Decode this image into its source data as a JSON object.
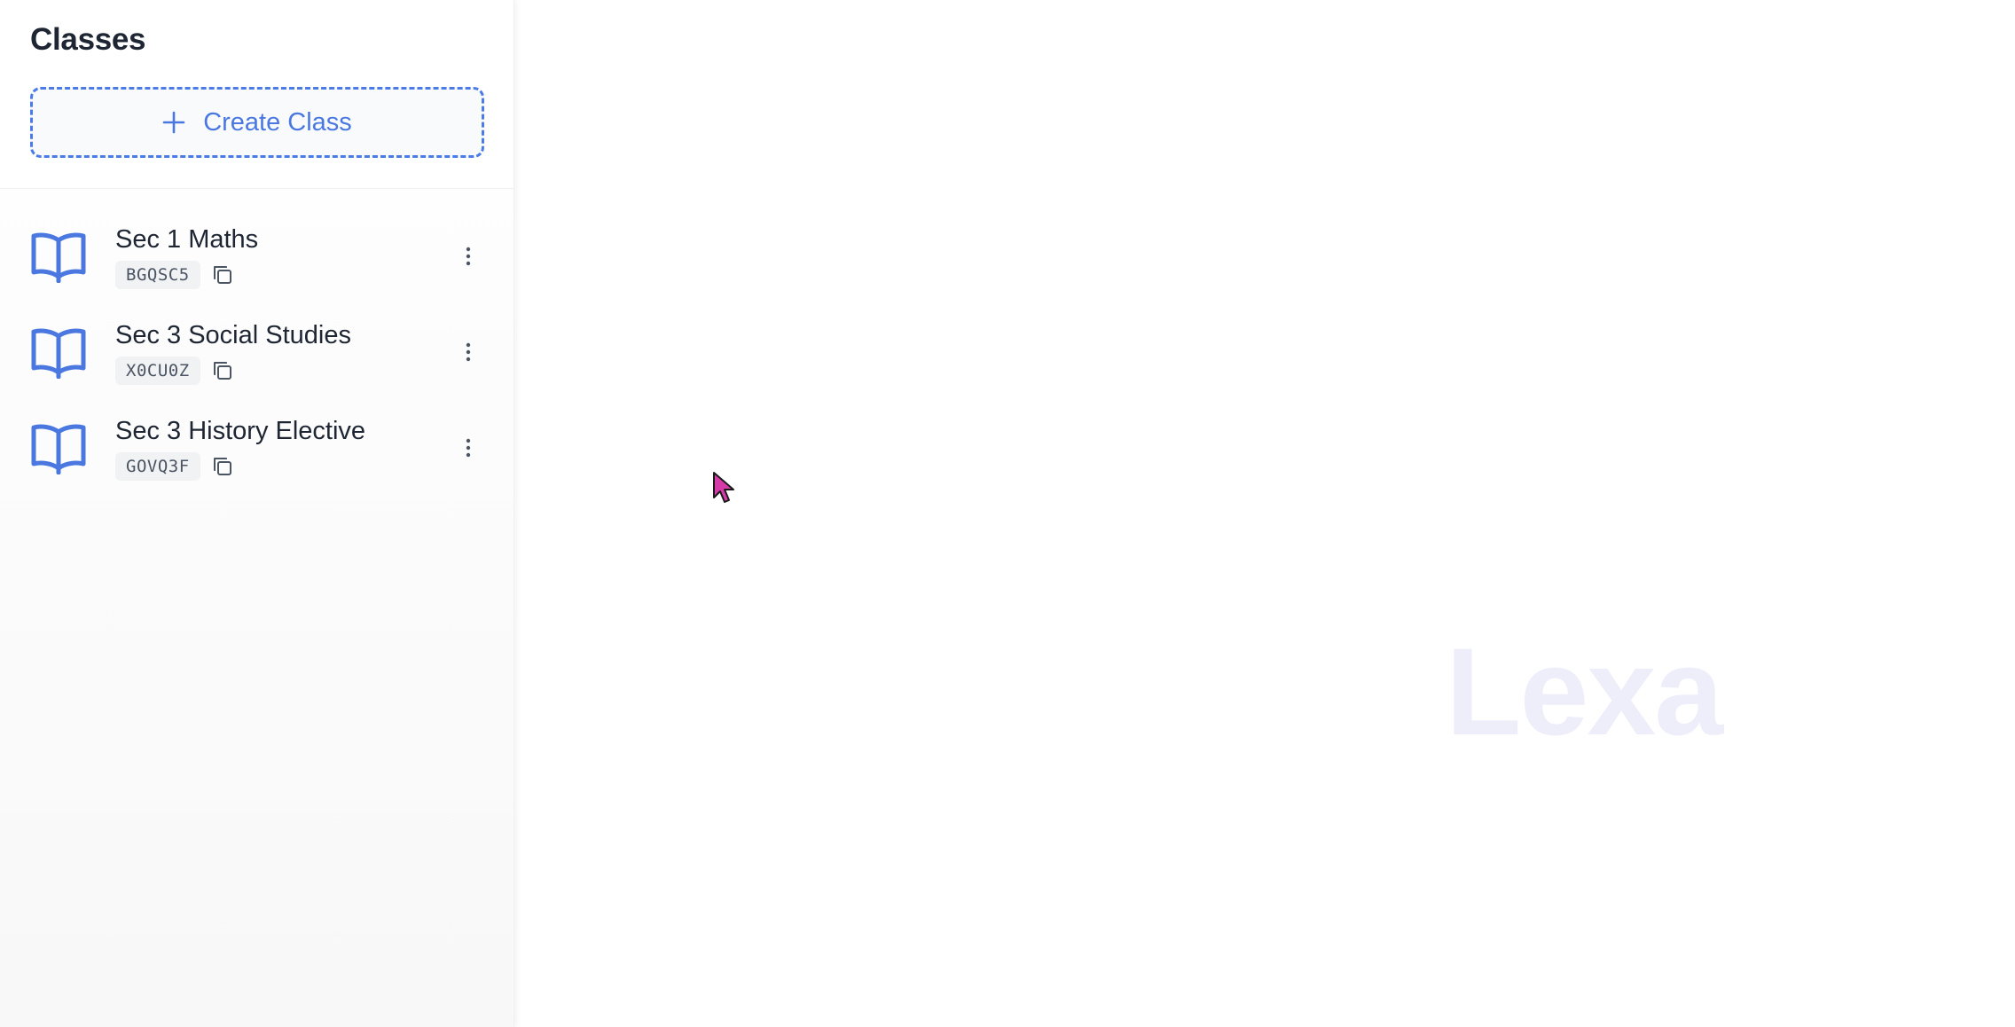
{
  "sidebar": {
    "title": "Classes",
    "create_button_label": "Create Class",
    "create_icon": "plus-icon",
    "classes": [
      {
        "name": "Sec 1 Maths",
        "code": "BGQSC5",
        "icon": "open-book-icon"
      },
      {
        "name": "Sec 3 Social Studies",
        "code": "X0CU0Z",
        "icon": "open-book-icon"
      },
      {
        "name": "Sec 3 History Elective",
        "code": "GOVQ3F",
        "icon": "open-book-icon"
      }
    ]
  },
  "main": {
    "watermark": "Lexa"
  },
  "colors": {
    "accent": "#4a78e0",
    "title_text": "#1e2533",
    "code_bg": "#f1f2f4",
    "watermark": "#eeeefa",
    "cursor": "#d63aa8"
  }
}
